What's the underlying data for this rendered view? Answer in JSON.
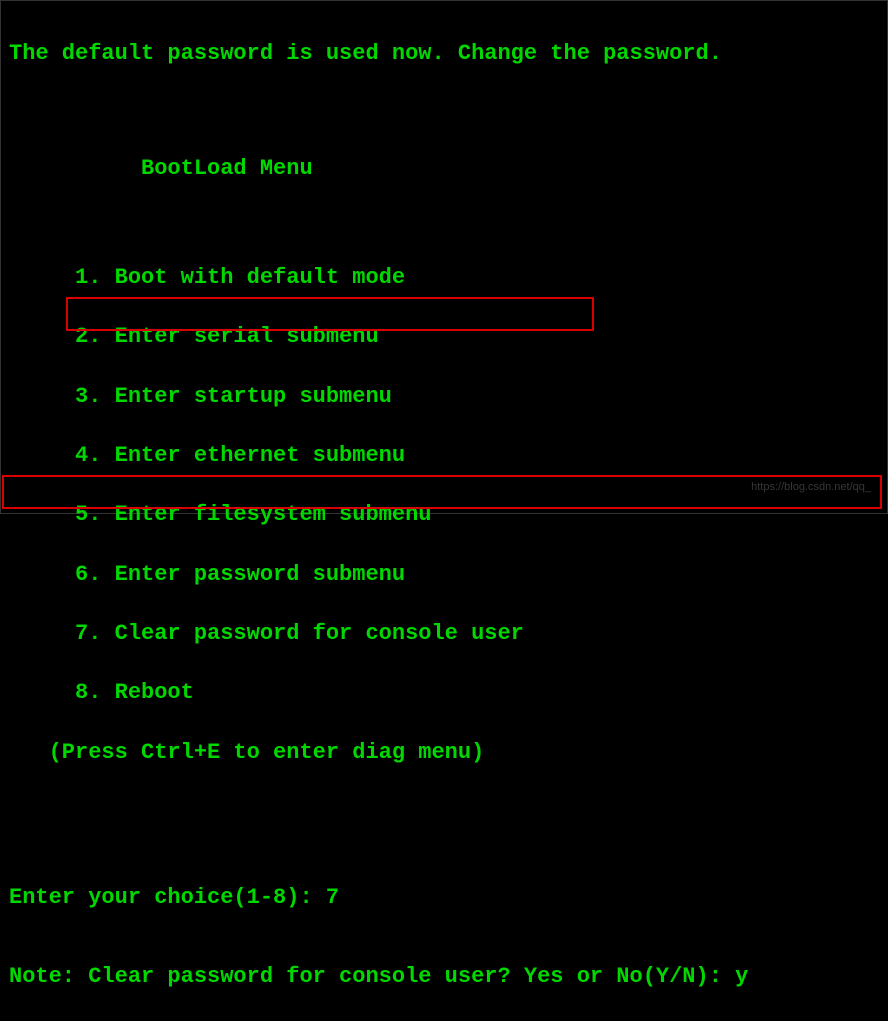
{
  "header": {
    "message": "The default password is used now. Change the password."
  },
  "menu": {
    "title": "          BootLoad Menu",
    "items": [
      "     1. Boot with default mode",
      "     2. Enter serial submenu",
      "     3. Enter startup submenu",
      "     4. Enter ethernet submenu",
      "     5. Enter filesystem submenu",
      "     6. Enter password submenu",
      "     7. Clear password for console user",
      "     8. Reboot"
    ],
    "hint": "   (Press Ctrl+E to enter diag menu)"
  },
  "prompt": {
    "label": "Enter your choice(1-8): ",
    "value": "7"
  },
  "note": {
    "text": "Note: Clear password for console user? Yes or No(Y/N): ",
    "input": "y"
  },
  "watermark": "https://blog.csdn.net/qq_"
}
